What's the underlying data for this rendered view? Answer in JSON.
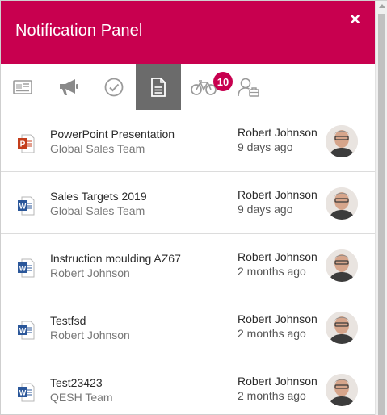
{
  "header": {
    "title": "Notification Panel",
    "close_glyph": "×"
  },
  "tabs": [
    {
      "icon": "newspaper-icon",
      "active": false
    },
    {
      "icon": "megaphone-icon",
      "active": false
    },
    {
      "icon": "check-circle-icon",
      "active": false
    },
    {
      "icon": "document-icon",
      "active": true
    },
    {
      "icon": "bicycle-icon",
      "active": false,
      "badge": "10"
    },
    {
      "icon": "user-briefcase-icon",
      "active": false
    }
  ],
  "items": [
    {
      "file_type": "powerpoint",
      "badge_letter": "P",
      "name": "PowerPoint Presentation",
      "group": "Global Sales Team",
      "author": "Robert Johnson",
      "time": "9 days ago"
    },
    {
      "file_type": "word",
      "badge_letter": "W",
      "name": "Sales Targets 2019",
      "group": "Global Sales Team",
      "author": "Robert Johnson",
      "time": "9 days ago"
    },
    {
      "file_type": "word",
      "badge_letter": "W",
      "name": "Instruction moulding AZ67",
      "group": "Robert Johnson",
      "author": "Robert Johnson",
      "time": "2 months ago"
    },
    {
      "file_type": "word",
      "badge_letter": "W",
      "name": "Testfsd",
      "group": "Robert Johnson",
      "author": "Robert Johnson",
      "time": "2 months ago"
    },
    {
      "file_type": "word",
      "badge_letter": "W",
      "name": "Test23423",
      "group": "QESH Team",
      "author": "Robert Johnson",
      "time": "2 months ago"
    }
  ],
  "colors": {
    "brand": "#c8004f",
    "active_tab": "#6b6b6b",
    "powerpoint": "#c43e1c",
    "word": "#2b579a"
  }
}
